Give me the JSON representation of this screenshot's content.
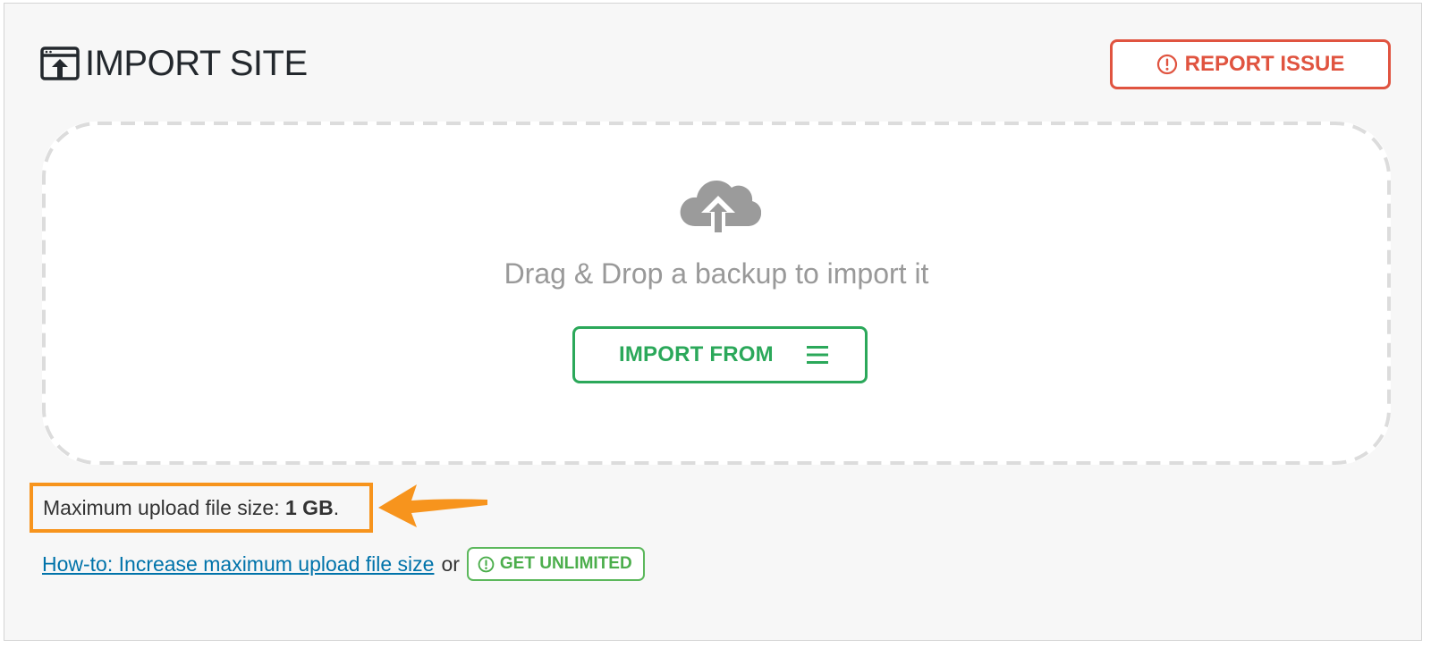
{
  "header": {
    "title": "IMPORT SITE",
    "title_icon": "import-site-icon",
    "report_button": {
      "label": "REPORT ISSUE",
      "icon": "exclamation-circle-icon",
      "color": "#e05440"
    }
  },
  "dropzone": {
    "icon": "cloud-upload-icon",
    "text": "Drag & Drop a backup to import it",
    "import_button": {
      "label": "IMPORT FROM",
      "icon": "menu-icon",
      "color": "#2ba85a"
    }
  },
  "upload_limit": {
    "label": "Maximum upload file size:",
    "value": "1 GB",
    "suffix": ".",
    "highlight_color": "#f7941d"
  },
  "footer": {
    "howto_link": "How-to: Increase maximum upload file size",
    "or_text": "or",
    "unlimited_button": {
      "label": "GET UNLIMITED",
      "icon": "exclamation-circle-icon",
      "color": "#4cae4c"
    }
  }
}
